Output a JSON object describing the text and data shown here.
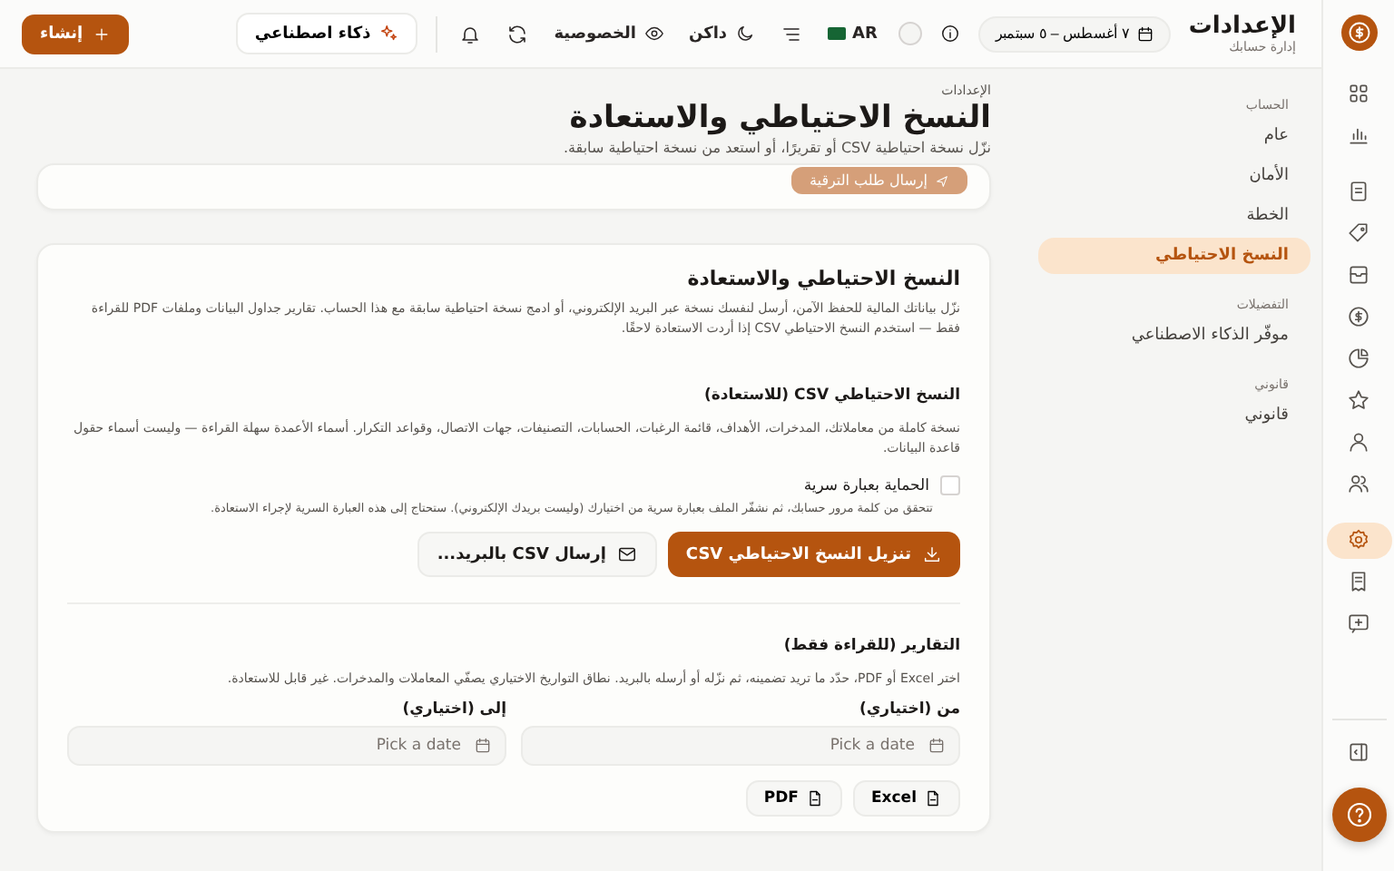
{
  "rail": {
    "items": [
      {
        "kind": "grid",
        "selected": false
      },
      {
        "kind": "chart",
        "selected": false
      },
      {
        "kind": "document",
        "selected": false
      },
      {
        "kind": "tag",
        "selected": false
      },
      {
        "kind": "inbox",
        "selected": false
      },
      {
        "kind": "coin",
        "selected": false
      },
      {
        "kind": "pie",
        "selected": false
      },
      {
        "kind": "star",
        "selected": false
      },
      {
        "kind": "user",
        "selected": false
      },
      {
        "kind": "users",
        "selected": false
      },
      {
        "kind": "gear",
        "selected": true
      },
      {
        "kind": "receipt",
        "selected": false
      },
      {
        "kind": "message",
        "selected": false
      }
    ]
  },
  "header": {
    "title": "الإعدادات",
    "subtitle": "إدارة حسابك",
    "date_range": "٧ أغسطس – ٥ سبتمبر",
    "language": "AR",
    "theme": "داكن",
    "privacy": "الخصوصية",
    "ai_button": "ذكاء اصطناعي",
    "create_button": "إنشاء"
  },
  "settings_nav": {
    "groups": [
      {
        "label": "الحساب",
        "items": [
          {
            "label": "عام",
            "selected": false
          },
          {
            "label": "الأمان",
            "selected": false
          },
          {
            "label": "الخطة",
            "selected": false
          },
          {
            "label": "النسخ الاحتياطي",
            "selected": true
          }
        ]
      },
      {
        "label": "التفضيلات",
        "items": [
          {
            "label": "موفّر الذكاء الاصطناعي",
            "selected": false
          }
        ]
      },
      {
        "label": "قانوني",
        "items": [
          {
            "label": "قانوني",
            "selected": false
          }
        ]
      }
    ]
  },
  "page": {
    "breadcrumb": "الإعدادات",
    "title": "النسخ الاحتياطي والاستعادة",
    "subtitle": "نزّل نسخة احتياطية CSV أو تقريرًا، أو استعد من نسخة احتياطية سابقة."
  },
  "upgrade_card": {
    "button": "إرسال طلب الترقية",
    "disabled": true
  },
  "backup_card": {
    "title": "النسخ الاحتياطي والاستعادة",
    "description": "نزّل بياناتك المالية للحفظ الآمن، أرسل لنفسك نسخة عبر البريد الإلكتروني، أو ادمج نسخة احتياطية سابقة مع هذا الحساب. تقارير جداول البيانات وملفات PDF للقراءة فقط — استخدم النسخ الاحتياطي CSV إذا أردت الاستعادة لاحقًا.",
    "csv": {
      "title": "النسخ الاحتياطي CSV (للاستعادة)",
      "description": "نسخة كاملة من معاملاتك، المدخرات، الأهداف، قائمة الرغبات، الحسابات، التصنيفات، جهات الاتصال، وقواعد التكرار. أسماء الأعمدة سهلة القراءة — وليست أسماء حقول قاعدة البيانات.",
      "passphrase": {
        "label": "الحماية بعبارة سرية",
        "checked": false,
        "hint": "تتحقق من كلمة مرور حسابك، ثم نشفّر الملف بعبارة سرية من اختيارك (وليست بريدك الإلكتروني). ستحتاج إلى هذه العبارة السرية لإجراء الاستعادة."
      },
      "download_button": "تنزيل النسخ الاحتياطي CSV",
      "email_button": "إرسال CSV بالبريد..."
    },
    "reports": {
      "title": "التقارير (للقراءة فقط)",
      "description": "اختر Excel أو PDF، حدّد ما تريد تضمينه، ثم نزّله أو أرسله بالبريد. نطاق التواريخ الاختياري يصفّي المعاملات والمدخرات. غير قابل للاستعادة.",
      "fields": [
        {
          "label": "من (اختياري)",
          "placeholder": "Pick a date"
        },
        {
          "label": "إلى (اختياري)",
          "placeholder": "Pick a date"
        }
      ],
      "formats": [
        "Excel",
        "PDF"
      ]
    }
  }
}
